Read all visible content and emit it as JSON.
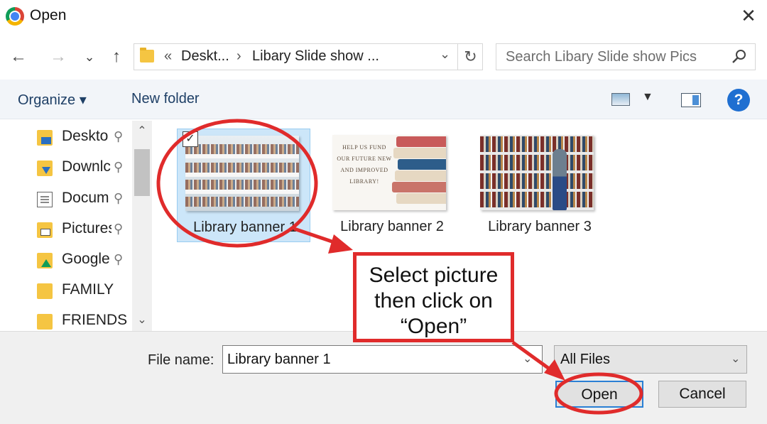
{
  "window": {
    "title": "Open",
    "app_icon": "chrome-icon"
  },
  "nav": {
    "back_glyph": "←",
    "forward_glyph": "→",
    "recent_glyph": "⌄",
    "up_glyph": "↑",
    "breadcrumb_overflow": "«",
    "breadcrumb": [
      "Deskt...",
      "Libary Slide show ..."
    ],
    "breadcrumb_sep": "›",
    "refresh_glyph": "↻",
    "search_placeholder": "Search Libary Slide show Pics"
  },
  "toolbar": {
    "organize": "Organize ▾",
    "new_folder": "New folder",
    "help": "?"
  },
  "sidebar": {
    "items": [
      {
        "label": "Deskto",
        "pinned": true,
        "icon": "desktop-folder-icon"
      },
      {
        "label": "Downlc",
        "pinned": true,
        "icon": "downloads-folder-icon"
      },
      {
        "label": "Docum",
        "pinned": true,
        "icon": "documents-icon"
      },
      {
        "label": "Pictures",
        "pinned": true,
        "icon": "pictures-folder-icon"
      },
      {
        "label": "Google",
        "pinned": true,
        "icon": "google-drive-folder-icon"
      },
      {
        "label": "FAMILY",
        "pinned": false,
        "icon": "folder-icon"
      },
      {
        "label": "FRIENDS",
        "pinned": false,
        "icon": "folder-icon"
      }
    ],
    "pin_glyph": "📌"
  },
  "files": [
    {
      "name": "Library banner 1",
      "selected": true
    },
    {
      "name": "Library banner 2",
      "selected": false
    },
    {
      "name": "Library banner 3",
      "selected": false
    }
  ],
  "thumb2_text": "HELP US FUND OUR FUTURE NEW AND IMPROVED LIBRARY!",
  "footer": {
    "file_name_label": "File name:",
    "file_name_value": "Library banner 1",
    "filter_value": "All Files",
    "open_button": "Open",
    "cancel_button": "Cancel"
  },
  "annotation": {
    "callout_text": "Select picture\nthen click on\n“Open”",
    "color": "#e02b2b"
  },
  "colors": {
    "accent": "#1f6fd1",
    "selection": "#cce6f9",
    "command_text": "#1e3f66"
  }
}
